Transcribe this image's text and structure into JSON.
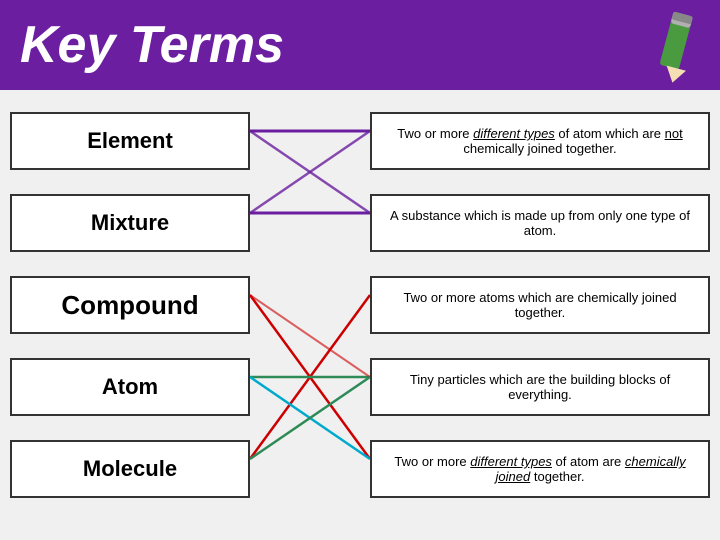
{
  "header": {
    "title": "Key Terms",
    "pencil_alt": "pencil icon"
  },
  "rows": [
    {
      "id": "element",
      "term": "Element",
      "definition_parts": [
        {
          "text": "Two or more ",
          "style": "normal"
        },
        {
          "text": "different types",
          "style": "underline-italic"
        },
        {
          "text": " of atom which are ",
          "style": "normal"
        },
        {
          "text": "not",
          "style": "underline"
        },
        {
          "text": " chemically joined together.",
          "style": "normal"
        }
      ],
      "line_color": "#6b1fa0"
    },
    {
      "id": "mixture",
      "term": "Mixture",
      "definition_parts": [
        {
          "text": "A substance which is made up from only one type of atom.",
          "style": "normal"
        }
      ],
      "line_color": "#6b1fa0"
    },
    {
      "id": "compound",
      "term": "Compound",
      "definition_parts": [
        {
          "text": "Two or more atoms which are chemically joined together.",
          "style": "normal"
        }
      ],
      "line_color": "#cc0000"
    },
    {
      "id": "atom",
      "term": "Atom",
      "definition_parts": [
        {
          "text": "Tiny particles which are the building blocks of everything.",
          "style": "normal"
        }
      ],
      "line_color": "#2e8b57"
    },
    {
      "id": "molecule",
      "term": "Molecule",
      "definition_parts": [
        {
          "text": "Two or more ",
          "style": "normal"
        },
        {
          "text": "different types",
          "style": "underline-italic"
        },
        {
          "text": " of atom are ",
          "style": "normal"
        },
        {
          "text": "chemically joined",
          "style": "underline-italic"
        },
        {
          "text": " together.",
          "style": "normal"
        }
      ],
      "line_color": "#00aacc"
    }
  ],
  "colors": {
    "header_bg": "#6b1fa0",
    "header_text": "#ffffff",
    "content_bg": "#f0f0f0",
    "box_border": "#333333",
    "box_bg": "#ffffff"
  }
}
